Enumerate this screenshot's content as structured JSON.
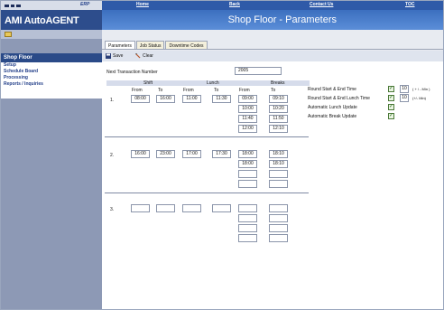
{
  "nav": {
    "erp": "ERP",
    "home": "Home",
    "back": "Back",
    "contact": "Contact Us",
    "toc": "TOC"
  },
  "brand": {
    "title": "AMI AutoAGENT"
  },
  "banner": {
    "title": "Shop Floor - Parameters"
  },
  "sidebar": {
    "section": "Shop Floor",
    "items": [
      {
        "label": "Setup"
      },
      {
        "label": "Schedule Board"
      },
      {
        "label": "Processing"
      },
      {
        "label": "Reports / Inquiries"
      }
    ]
  },
  "tabs": [
    {
      "label": "Parameters"
    },
    {
      "label": "Job Status"
    },
    {
      "label": "Downtime Codes"
    }
  ],
  "toolbar": {
    "save": "Save",
    "clear": "Clear"
  },
  "form": {
    "next_txn_label": "Next Transaction Number",
    "next_txn": "2005",
    "headers": {
      "shift": "Shift",
      "lunch": "Lunch",
      "breaks": "Breaks",
      "from": "From",
      "to": "To"
    },
    "shifts": [
      {
        "num": "1.",
        "shift_from": "08:00",
        "shift_to": "16:00",
        "lunch_from": "11:00",
        "lunch_to": "11:30",
        "breaks": [
          [
            "09:00",
            "09:10"
          ],
          [
            "10:00",
            "10:20"
          ],
          [
            "11:40",
            "11:50"
          ],
          [
            "12:00",
            "12:10"
          ]
        ]
      },
      {
        "num": "2.",
        "shift_from": "16:00",
        "shift_to": "23:00",
        "lunch_from": "17:00",
        "lunch_to": "17:30",
        "breaks": [
          [
            "18:00",
            "18:10"
          ],
          [
            "18:00",
            "18:10"
          ],
          [
            "",
            ""
          ],
          [
            "",
            ""
          ]
        ]
      },
      {
        "num": "3.",
        "shift_from": "",
        "shift_to": "",
        "lunch_from": "",
        "lunch_to": "",
        "breaks": [
          [
            "",
            ""
          ],
          [
            "",
            ""
          ],
          [
            "",
            ""
          ],
          [
            "",
            ""
          ]
        ]
      }
    ],
    "options": [
      {
        "label": "Round Start & End Time",
        "checked": true,
        "value": "10",
        "unit": "( + / - Min )"
      },
      {
        "label": "Round Start & End Lunch Time",
        "checked": true,
        "value": "10",
        "unit": "(+/- Min)"
      },
      {
        "label": "Automatic Lunch Update",
        "checked": true
      },
      {
        "label": "Automatic Break Update",
        "checked": true
      }
    ]
  },
  "colors": {
    "nav": "#2f5aa8",
    "sidebar": "#8d99b5",
    "section": "#2a4a88"
  }
}
